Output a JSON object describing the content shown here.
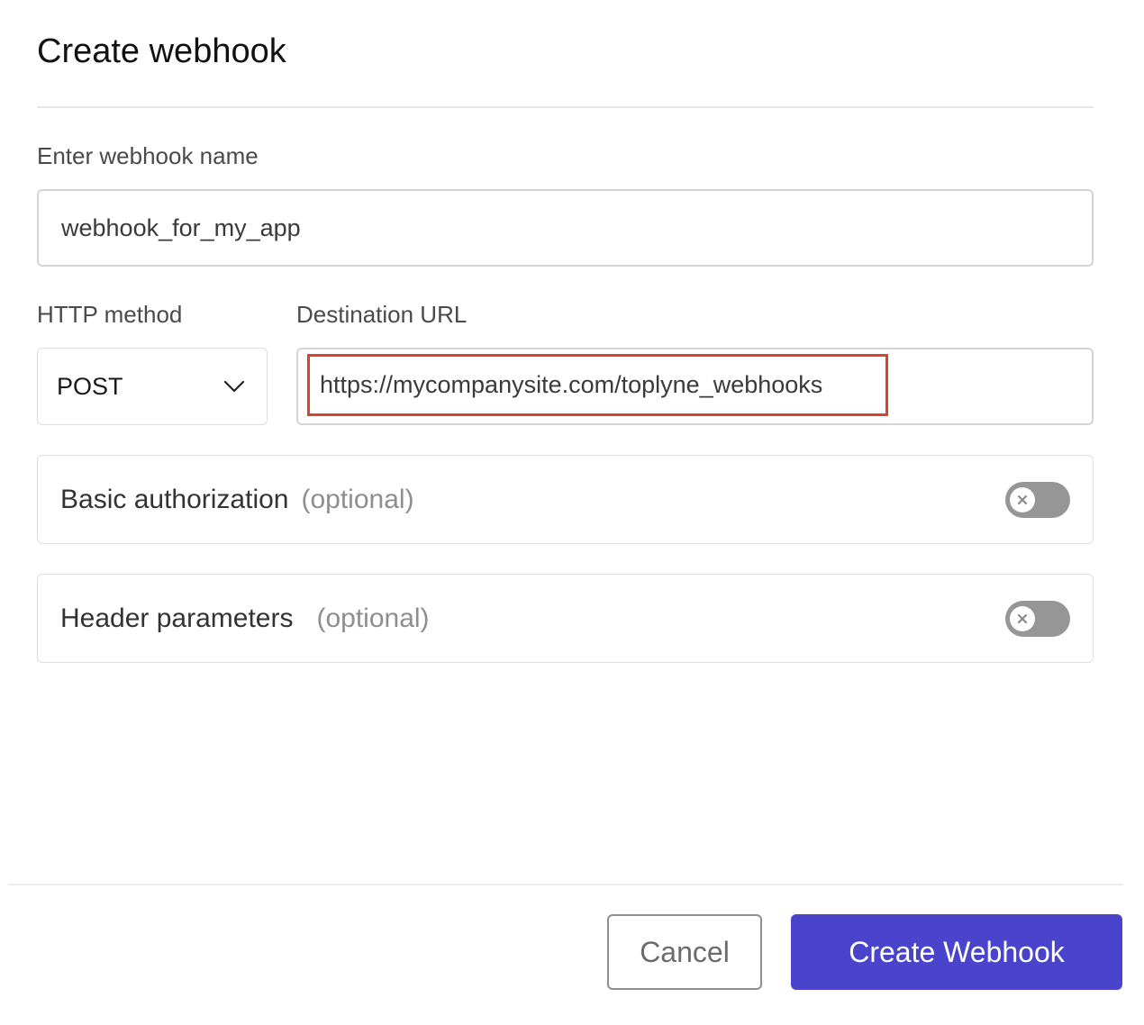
{
  "dialog": {
    "title": "Create webhook"
  },
  "form": {
    "name_label": "Enter webhook name",
    "name_value": "webhook_for_my_app",
    "method_label": "HTTP method",
    "method_value": "POST",
    "url_label": "Destination URL",
    "url_value": "https://mycompanysite.com/toplyne_webhooks",
    "options": [
      {
        "label": "Basic authorization",
        "optional": "(optional)",
        "enabled": false
      },
      {
        "label": "Header parameters",
        "optional": "(optional)",
        "enabled": false
      }
    ]
  },
  "footer": {
    "cancel_label": "Cancel",
    "create_label": "Create Webhook"
  },
  "colors": {
    "primary": "#4a44cc",
    "highlight": "#d8432d",
    "toggle_off": "#969696"
  }
}
